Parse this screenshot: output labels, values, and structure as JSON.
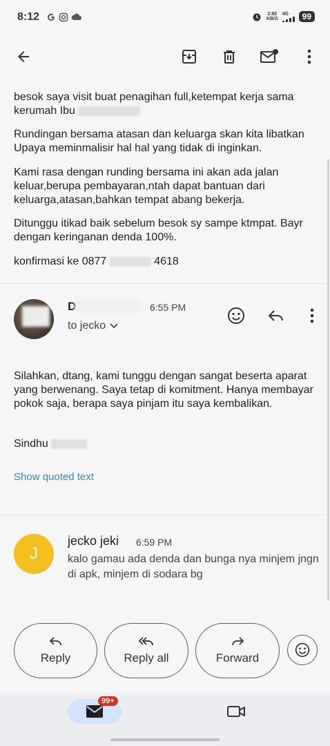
{
  "status_bar": {
    "time": "8:12",
    "speed_value": "2.92",
    "speed_unit": "KB/S",
    "network": "4G",
    "battery": "99"
  },
  "toolbar": {
    "back": "back-arrow",
    "archive": "archive-icon",
    "delete": "trash-icon",
    "mark_unread": "mail-unread-icon",
    "more": "more-vert-icon"
  },
  "message_top": {
    "p1_a": "besok saya visit buat penagihan full,ketempat kerja sama",
    "p1_b": "kerumah Ibu",
    "p2": "Rundingan bersama atasan dan keluarga skan kita libatkan Upaya meminmalisir hal hal yang tidak di inginkan.",
    "p3": "Kami rasa dengan runding bersama ini akan ada jalan keluar,berupa pembayaran,ntah dapat bantuan dari keluarga,atasan,bahkan tempat abang bekerja.",
    "p4": "Ditunggu itikad baik sebelum besok sy sampe ktmpat. Bayr dengan keringanan denda 100%.",
    "p5_a": "konfirmasi ke 0877",
    "p5_b": "4618"
  },
  "message_1": {
    "sender_initial": "D",
    "time": "6:55 PM",
    "to": "to jecko",
    "body": "Silahkan, dtang, kami tunggu dengan sangat beserta aparat yang berwenang. Saya tetap di komitment. Hanya membayar pokok saja, berapa saya pinjam itu saya kembalikan.",
    "signature": "Sindhu",
    "show_quoted": "Show quoted text"
  },
  "message_2": {
    "avatar_letter": "J",
    "sender": "jecko jeki",
    "time": "6:59 PM",
    "preview": "kalo gamau ada denda dan bunga nya minjem jngn di apk, minjem di sodara bg"
  },
  "actions": {
    "reply": "Reply",
    "reply_all": "Reply all",
    "forward": "Forward"
  },
  "bottom_nav": {
    "mail_badge": "99+"
  },
  "colors": {
    "accent_link": "#3b82c4",
    "avatar_j": "#f4c020",
    "badge": "#d93025",
    "nav_pill": "#d3e3fd"
  }
}
